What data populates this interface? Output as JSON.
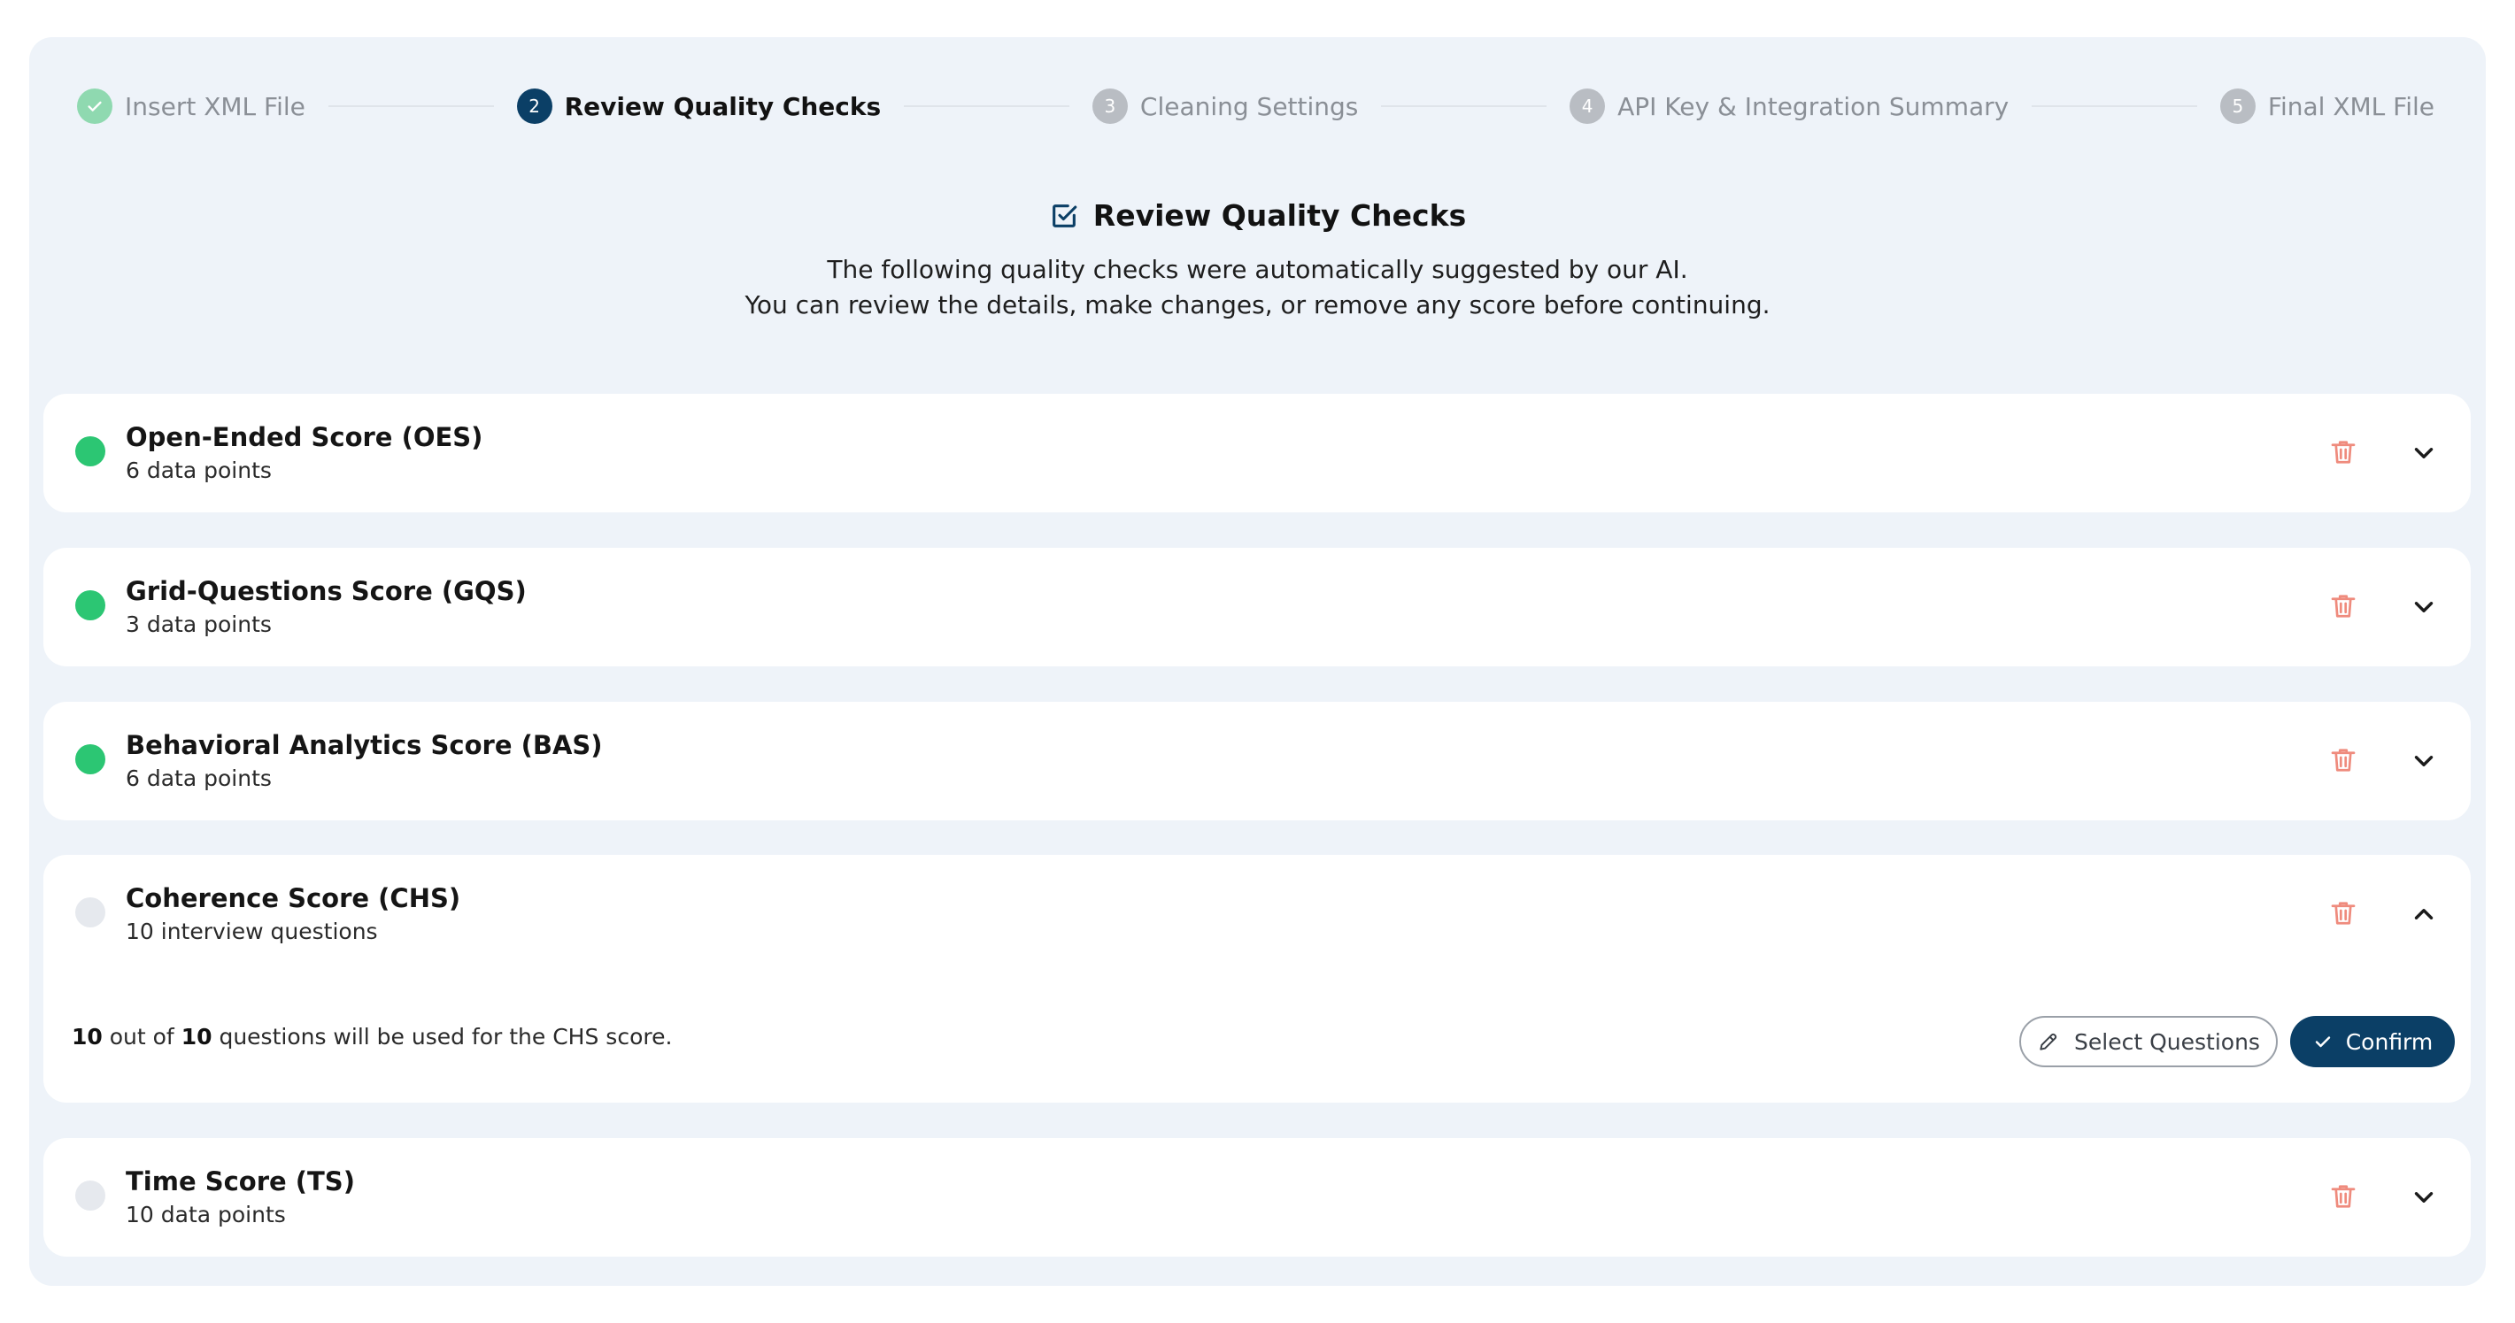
{
  "stepper": {
    "steps": [
      {
        "number": "1",
        "label": "Insert XML File",
        "state": "done",
        "icon": "check-icon"
      },
      {
        "number": "2",
        "label": "Review Quality Checks",
        "state": "active"
      },
      {
        "number": "3",
        "label": "Cleaning Settings",
        "state": "pending"
      },
      {
        "number": "4",
        "label": "API Key & Integration Summary",
        "state": "pending"
      },
      {
        "number": "5",
        "label": "Final XML File",
        "state": "pending"
      }
    ]
  },
  "header": {
    "icon": "checkbox-check-icon",
    "title": "Review Quality Checks",
    "description_line1": "The following quality checks were automatically suggested by our AI.",
    "description_line2": "You can review the details, make changes, or remove any score before continuing."
  },
  "scores": [
    {
      "title": "Open-Ended Score (OES)",
      "subtitle": "6 data points",
      "status": "active",
      "expanded": false
    },
    {
      "title": "Grid-Questions Score (GQS)",
      "subtitle": "3 data points",
      "status": "active",
      "expanded": false
    },
    {
      "title": "Behavioral Analytics Score (BAS)",
      "subtitle": "6 data points",
      "status": "active",
      "expanded": false
    },
    {
      "title": "Coherence Score (CHS)",
      "subtitle": "10 interview questions",
      "status": "inactive",
      "expanded": true,
      "detail": {
        "used_count": "10",
        "out_of_label": "out of",
        "total_count": "10",
        "suffix": "questions will be used for the CHS score."
      },
      "select_button_label": "Select Questions",
      "confirm_button_label": "Confirm"
    },
    {
      "title": "Time Score (TS)",
      "subtitle": "10 data points",
      "status": "inactive",
      "expanded": false
    }
  ],
  "colors": {
    "accent": "#0b3f66",
    "active_dot": "#2cc673",
    "inactive_dot": "#e6e9ee",
    "delete": "#ef8b7d",
    "panel_bg": "#eef3f9"
  }
}
